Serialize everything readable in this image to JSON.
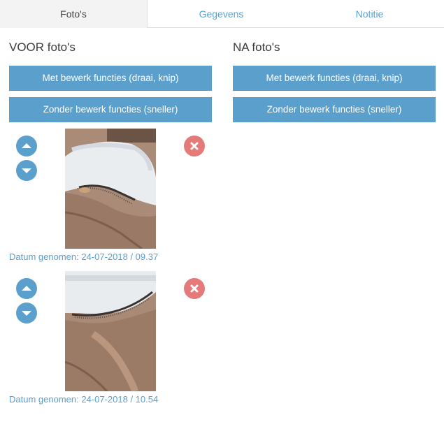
{
  "tabs": [
    {
      "label": "Foto's",
      "active": true
    },
    {
      "label": "Gegevens",
      "active": false
    },
    {
      "label": "Notitie",
      "active": false
    }
  ],
  "voor": {
    "title": "VOOR foto's",
    "btn_edit": "Met bewerk functies (draai, knip)",
    "btn_noedit": "Zonder bewerk functies (sneller)",
    "photos": [
      {
        "date": "Datum genomen: 24-07-2018 / 09.37"
      },
      {
        "date": "Datum genomen: 24-07-2018 / 10.54"
      }
    ]
  },
  "na": {
    "title": "NA foto's",
    "btn_edit": "Met bewerk functies (draai, knip)",
    "btn_noedit": "Zonder bewerk functies (sneller)"
  },
  "icons": {
    "move_up": "chevron-up-icon",
    "move_down": "chevron-down-icon",
    "delete": "close-icon"
  },
  "colors": {
    "accent": "#5b9fcd",
    "link": "#5aa0cf",
    "delete": "#e47a7a",
    "active_tab_bg": "#f3f3f3"
  }
}
